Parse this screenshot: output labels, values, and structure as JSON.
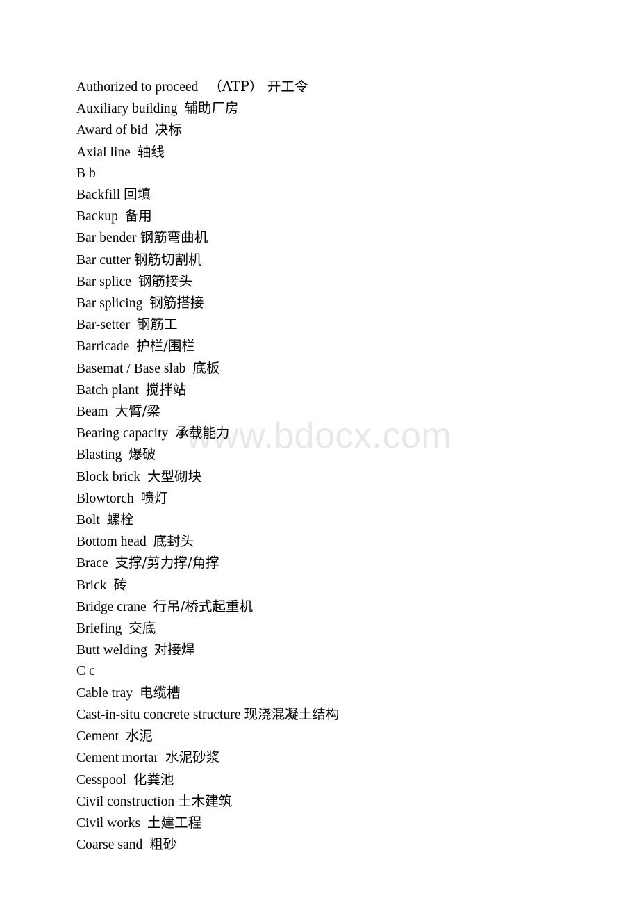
{
  "document": {
    "background_color": "#ffffff",
    "text_color": "#000000",
    "watermark": {
      "text": "www.bdocx.com",
      "color": "#e8e8e8"
    }
  },
  "glossary": {
    "entries": [
      {
        "term": "Authorized to proceed",
        "gap": "wide",
        "gloss": "（ATP） 开工令"
      },
      {
        "term": "Auxiliary building",
        "gap": "normal",
        "gloss": "辅助厂房"
      },
      {
        "term": "Award of bid",
        "gap": "normal",
        "gloss": "决标"
      },
      {
        "term": "Axial line",
        "gap": "normal",
        "gloss": "轴线"
      },
      {
        "term": "B b",
        "gap": "none",
        "gloss": ""
      },
      {
        "term": "Backfill",
        "gap": "thin",
        "gloss": "回填"
      },
      {
        "term": "Backup",
        "gap": "normal",
        "gloss": "备用"
      },
      {
        "term": "Bar bender",
        "gap": "thin",
        "gloss": "钢筋弯曲机"
      },
      {
        "term": "Bar cutter",
        "gap": "thin",
        "gloss": "钢筋切割机"
      },
      {
        "term": "Bar splice",
        "gap": "normal",
        "gloss": "钢筋接头"
      },
      {
        "term": "Bar splicing",
        "gap": "normal",
        "gloss": "钢筋搭接"
      },
      {
        "term": "Bar-setter",
        "gap": "normal",
        "gloss": "钢筋工"
      },
      {
        "term": "Barricade",
        "gap": "normal",
        "gloss": "护栏/围栏"
      },
      {
        "term": "Basemat / Base slab",
        "gap": "normal",
        "gloss": "底板"
      },
      {
        "term": "Batch plant",
        "gap": "normal",
        "gloss": "搅拌站"
      },
      {
        "term": "Beam",
        "gap": "normal",
        "gloss": "大臂/梁"
      },
      {
        "term": "Bearing capacity",
        "gap": "normal",
        "gloss": "承载能力"
      },
      {
        "term": "Blasting",
        "gap": "normal",
        "gloss": "爆破"
      },
      {
        "term": "Block brick",
        "gap": "normal",
        "gloss": "大型砌块"
      },
      {
        "term": "Blowtorch",
        "gap": "normal",
        "gloss": "喷灯"
      },
      {
        "term": "Bolt",
        "gap": "normal",
        "gloss": "螺栓"
      },
      {
        "term": "Bottom head",
        "gap": "normal",
        "gloss": "底封头"
      },
      {
        "term": "Brace",
        "gap": "normal",
        "gloss": "支撑/剪力撑/角撑"
      },
      {
        "term": "Brick",
        "gap": "normal",
        "gloss": "砖"
      },
      {
        "term": "Bridge crane",
        "gap": "normal",
        "gloss": "行吊/桥式起重机"
      },
      {
        "term": "Briefing",
        "gap": "normal",
        "gloss": "交底"
      },
      {
        "term": "Butt welding",
        "gap": "normal",
        "gloss": "对接焊"
      },
      {
        "term": "C c",
        "gap": "none",
        "gloss": ""
      },
      {
        "term": "Cable tray",
        "gap": "normal",
        "gloss": "电缆槽"
      },
      {
        "term": "Cast-in-situ concrete structure",
        "gap": "thin",
        "gloss": "现浇混凝土结构"
      },
      {
        "term": "Cement",
        "gap": "normal",
        "gloss": "水泥"
      },
      {
        "term": "Cement mortar",
        "gap": "normal",
        "gloss": "水泥砂浆"
      },
      {
        "term": "Cesspool",
        "gap": "normal",
        "gloss": "化粪池"
      },
      {
        "term": "Civil construction",
        "gap": "thin",
        "gloss": "土木建筑"
      },
      {
        "term": "Civil works",
        "gap": "normal",
        "gloss": "土建工程"
      },
      {
        "term": "Coarse sand",
        "gap": "normal",
        "gloss": "粗砂"
      }
    ]
  }
}
